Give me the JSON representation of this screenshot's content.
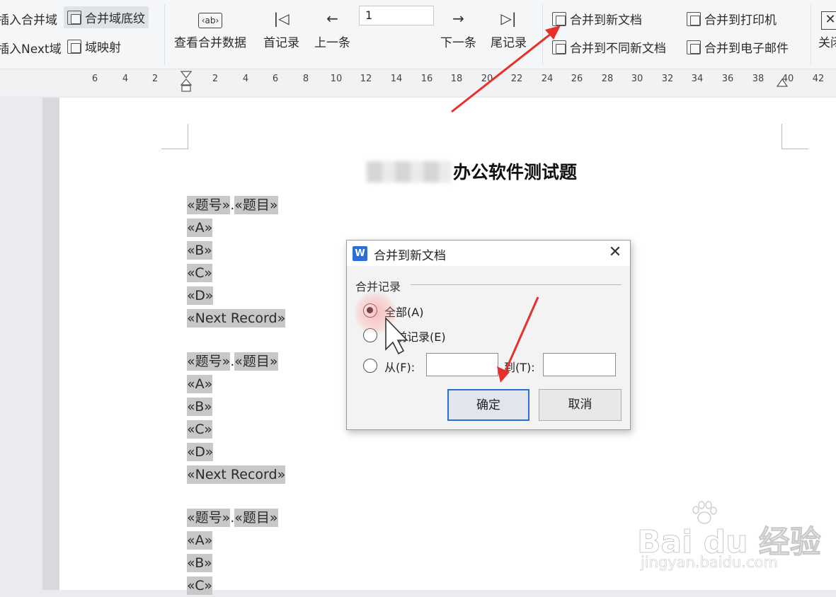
{
  "ribbon": {
    "insert_merge_field": "插入合并域",
    "merge_field_shading": "合并域底纹",
    "insert_next_field": "插入Next域",
    "field_mapping": "域映射",
    "view_merged_data": "查看合并数据",
    "view_glyph": "‹ab›",
    "first_record": "首记录",
    "prev_record": "上一条",
    "record_number": "1",
    "next_record": "下一条",
    "last_record": "尾记录",
    "merge_to_new_doc": "合并到新文档",
    "merge_to_diff_new_docs": "合并到不同新文档",
    "merge_to_printer": "合并到打印机",
    "merge_to_email": "合并到电子邮件",
    "close": "关闭"
  },
  "ruler": {
    "ticks": [
      "6",
      "4",
      "2",
      "2",
      "4",
      "6",
      "8",
      "10",
      "12",
      "14",
      "16",
      "18",
      "20",
      "22",
      "24",
      "26",
      "28",
      "30",
      "32",
      "34",
      "36",
      "38",
      "40",
      "42"
    ]
  },
  "document": {
    "title": "办公软件测试题",
    "blocks": [
      {
        "q_num": "«题号»",
        "dot": ".",
        "q_text": "«题目»",
        "a": "«A»",
        "b": "«B»",
        "c": "«C»",
        "d": "«D»",
        "next": "«Next Record»"
      },
      {
        "q_num": "«题号»",
        "dot": ".",
        "q_text": "«题目»",
        "a": "«A»",
        "b": "«B»",
        "c": "«C»",
        "d": "«D»",
        "next": "«Next Record»"
      },
      {
        "q_num": "«题号»",
        "dot": ".",
        "q_text": "«题目»",
        "a": "«A»",
        "b": "«B»",
        "c": "«C»"
      }
    ]
  },
  "dialog": {
    "logo": "W",
    "title": "合并到新文档",
    "close_glyph": "✕",
    "group_label": "合并记录",
    "opt_all": "全部(A)",
    "opt_current": "当前记录(E)",
    "opt_from": "从(F):",
    "opt_to": "到(T):",
    "from_value": "",
    "to_value": "",
    "ok": "确定",
    "cancel": "取消",
    "selected": "all"
  },
  "watermark": {
    "brand": "Bai du 经验",
    "url": "jingyan.baidu.com"
  },
  "colors": {
    "annotation_arrow": "#e8302a",
    "dialog_accent": "#2a6fd6",
    "field_shading": "#c8c8c8"
  }
}
